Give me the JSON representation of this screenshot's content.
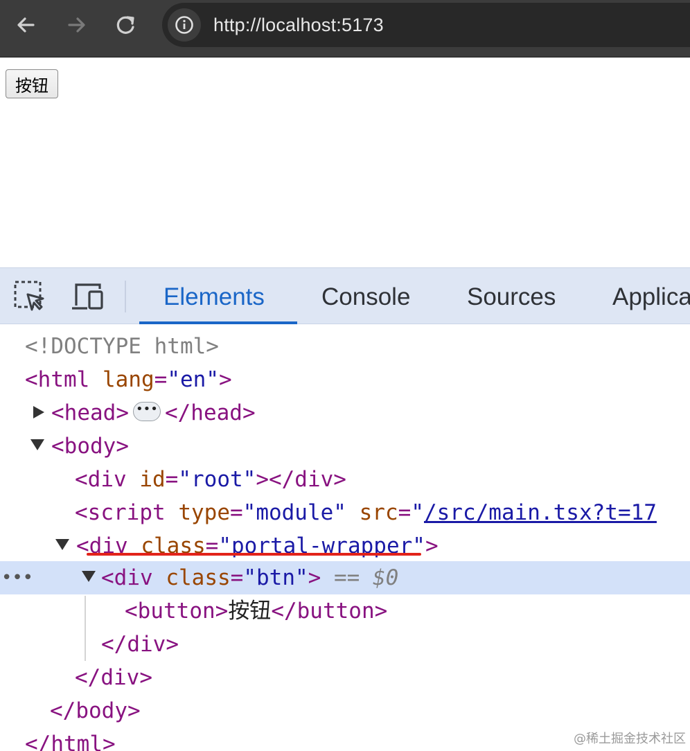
{
  "browser": {
    "url": "http://localhost:5173",
    "nav_icons": [
      "back-arrow-icon",
      "forward-arrow-icon",
      "reload-icon",
      "info-icon"
    ]
  },
  "page": {
    "button_label": "按钮"
  },
  "devtools": {
    "tabs": [
      "Elements",
      "Console",
      "Sources",
      "Applica"
    ],
    "active_tab": "Elements",
    "icons": [
      "inspect-element-icon",
      "device-toolbar-icon"
    ]
  },
  "dom_tree": {
    "doctype": "<!DOCTYPE html>",
    "html_open": "<html",
    "html_lang_attr": "lang",
    "html_lang_val": "\"en\"",
    "head_open": "<head>",
    "head_ellipsis": "•••",
    "head_close": "</head>",
    "body_open": "<body>",
    "root_div_open": "<div",
    "root_id_attr": "id",
    "root_id_val": "\"root\"",
    "root_div_close": "></div>",
    "script_open": "<script",
    "script_type_attr": "type",
    "script_type_val": "\"module\"",
    "script_src_attr": "src",
    "script_src_quote": "\"",
    "script_src_val": "/src/main.tsx?t=17",
    "wrapper_open": "<div",
    "wrapper_class_attr": "class",
    "wrapper_class_val": "\"portal-wrapper\"",
    "btn_div_open": "<div",
    "btn_class_attr": "class",
    "btn_class_val": "\"btn\"",
    "selected_marker": "== $0",
    "button_open": "<button>",
    "button_text": "按钮",
    "button_close": "</button>",
    "div_close": "</div>",
    "body_close": "</body>",
    "html_close": "</html>",
    "row_dots": "•••"
  },
  "watermark": "@稀土掘金技术社区",
  "colors": {
    "tag": "#881280",
    "attr": "#994500",
    "value": "#1a1aa6",
    "selection": "#d3e1f9",
    "highlight_underline": "#e2231a",
    "active_tab": "#1a66c7"
  }
}
